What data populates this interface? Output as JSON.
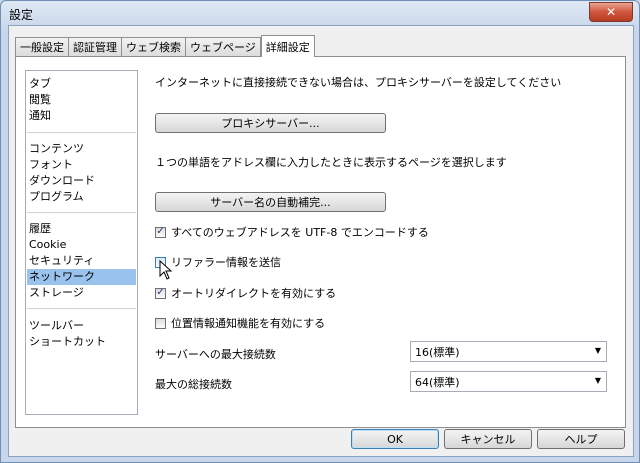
{
  "window": {
    "title": "設定",
    "close_glyph": "✕"
  },
  "tabs": [
    {
      "label": "一般設定",
      "active": false
    },
    {
      "label": "認証管理",
      "active": false
    },
    {
      "label": "ウェブ検索",
      "active": false
    },
    {
      "label": "ウェブページ",
      "active": false
    },
    {
      "label": "詳細設定",
      "active": true
    }
  ],
  "sidebar": {
    "items": [
      {
        "label": "タブ"
      },
      {
        "label": "閲覧"
      },
      {
        "label": "通知"
      },
      {
        "label": "コンテンツ"
      },
      {
        "label": "フォント"
      },
      {
        "label": "ダウンロード"
      },
      {
        "label": "プログラム"
      },
      {
        "label": "履歴"
      },
      {
        "label": "Cookie"
      },
      {
        "label": "セキュリティ"
      },
      {
        "label": "ネットワーク",
        "selected": true
      },
      {
        "label": "ストレージ"
      },
      {
        "label": "ツールバー"
      },
      {
        "label": "ショートカット"
      }
    ]
  },
  "network": {
    "proxy_description": "インターネットに直接接続できない場合は、プロキシサーバーを設定してください",
    "proxy_button": "プロキシサーバー...",
    "address_description": "１つの単語をアドレス欄に入力したときに表示するページを選択します",
    "autocomplete_button": "サーバー名の自動補完...",
    "checkboxes": [
      {
        "label": "すべてのウェブアドレスを UTF-8 でエンコードする",
        "checked": true
      },
      {
        "label": "リファラー情報を送信",
        "checked": false
      },
      {
        "label": "オートリダイレクトを有効にする",
        "checked": true
      },
      {
        "label": "位置情報通知機能を有効にする",
        "checked": false
      }
    ],
    "check_glyph": "✓",
    "max_per_server_label": "サーバーへの最大接続数",
    "max_per_server_value": "16(標準)",
    "max_total_label": "最大の総接続数",
    "max_total_value": "64(標準)",
    "dropdown_glyph": "▼"
  },
  "footer": {
    "ok": "OK",
    "cancel": "キャンセル",
    "help": "ヘルプ"
  }
}
